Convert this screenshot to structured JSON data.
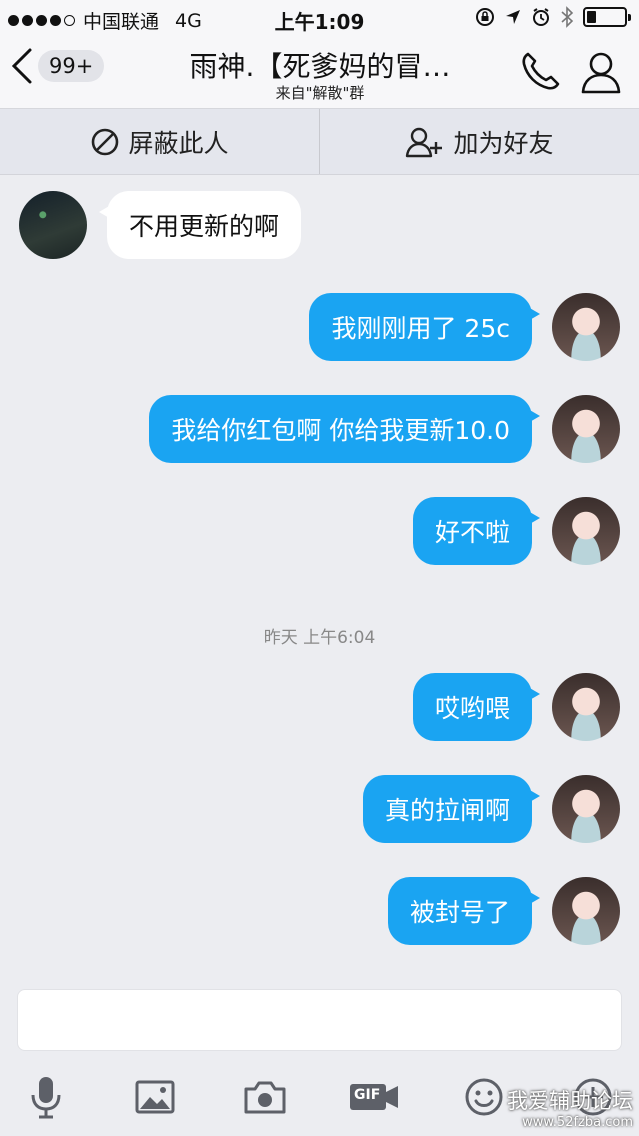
{
  "status_bar": {
    "carrier": "中国联通",
    "network": "4G",
    "time": "上午1:09",
    "signal_bars": 4,
    "signal_max": 5,
    "battery_level": 0.25
  },
  "nav": {
    "back_badge": "99+",
    "title": "雨神.【死爹妈的冒…",
    "subtitle": "来自\"解散\"群"
  },
  "actions": {
    "block_label": "屏蔽此人",
    "add_friend_label": "加为好友"
  },
  "messages": [
    {
      "sender": "other",
      "text": "不用更新的啊"
    },
    {
      "sender": "me",
      "text": "我刚刚用了 25c"
    },
    {
      "sender": "me",
      "text": "我给你红包啊 你给我更新10.0"
    },
    {
      "sender": "me",
      "text": "好不啦"
    },
    {
      "sender": "me",
      "text": "哎哟喂"
    },
    {
      "sender": "me",
      "text": "真的拉闸啊"
    },
    {
      "sender": "me",
      "text": "被封号了"
    }
  ],
  "timestamp": "昨天 上午6:04",
  "input": {
    "value": "",
    "placeholder": ""
  },
  "toolbar": {
    "gif_label": "GIF"
  },
  "watermark": {
    "line1": "我爱辅助论坛",
    "line2": "www.52fzba.com"
  },
  "colors": {
    "bubble_me": "#1aa4f2",
    "bubble_other": "#ffffff",
    "background": "#ecedf1"
  }
}
